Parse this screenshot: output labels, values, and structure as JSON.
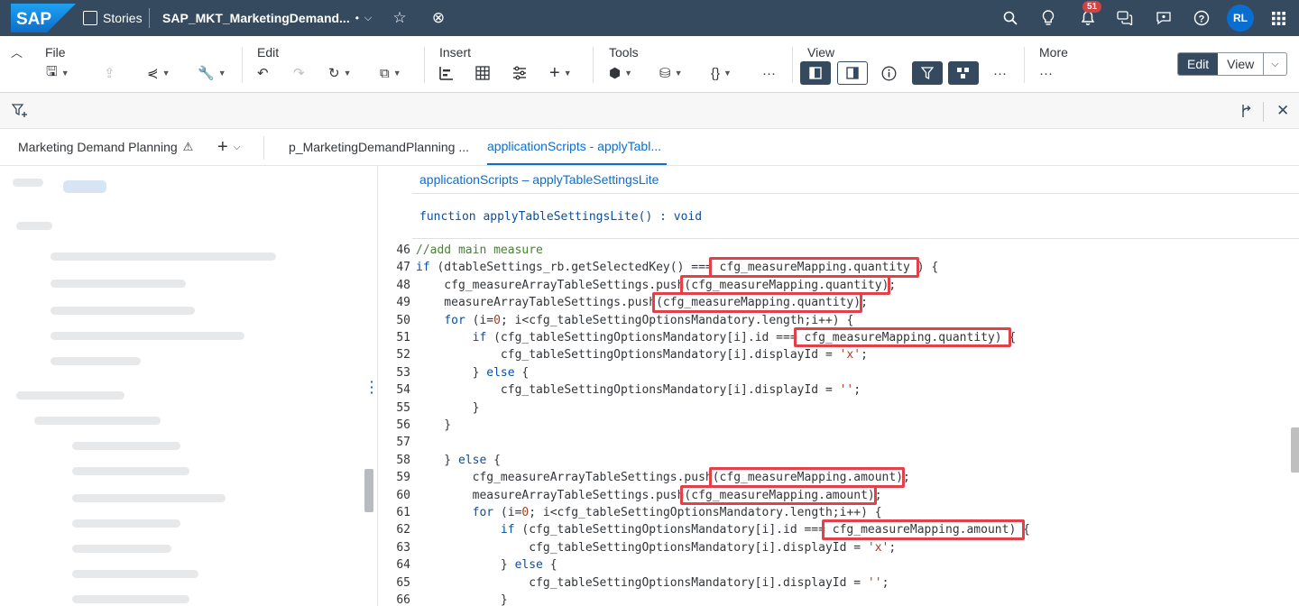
{
  "shell": {
    "logo_text": "SAP",
    "product": "Stories",
    "document_title": "SAP_MKT_MarketingDemand...",
    "modified_marker": "•",
    "notification_count": "51",
    "user_initials": "RL"
  },
  "toolbar": {
    "groups": [
      "File",
      "Edit",
      "Insert",
      "Tools",
      "View",
      "More"
    ],
    "mode_edit": "Edit",
    "mode_view": "View",
    "more_dots": "···"
  },
  "tabs": [
    {
      "label": "Marketing Demand Planning"
    },
    {
      "label": "p_MarketingDemandPlanning ..."
    },
    {
      "label": "applicationScripts - applyTabl..."
    }
  ],
  "editor": {
    "title": "applicationScripts – applyTableSettingsLite",
    "signature": "function applyTableSettingsLite() : void",
    "lines": [
      {
        "n": "46",
        "code": "//add main measure"
      },
      {
        "n": "47",
        "code": "if (dtableSettings_rb.getSelectedKey() === cfg_measureMapping.quantity ) {"
      },
      {
        "n": "48",
        "code": "    cfg_measureArrayTableSettings.push(cfg_measureMapping.quantity);"
      },
      {
        "n": "49",
        "code": "    measureArrayTableSettings.push(cfg_measureMapping.quantity);"
      },
      {
        "n": "50",
        "code": "    for (i=0; i<cfg_tableSettingOptionsMandatory.length;i++) {"
      },
      {
        "n": "51",
        "code": "        if (cfg_tableSettingOptionsMandatory[i].id === cfg_measureMapping.quantity) {"
      },
      {
        "n": "52",
        "code": "            cfg_tableSettingOptionsMandatory[i].displayId = 'x';"
      },
      {
        "n": "53",
        "code": "        } else {"
      },
      {
        "n": "54",
        "code": "            cfg_tableSettingOptionsMandatory[i].displayId = '';"
      },
      {
        "n": "55",
        "code": "        }"
      },
      {
        "n": "56",
        "code": "    }"
      },
      {
        "n": "57",
        "code": ""
      },
      {
        "n": "58",
        "code": "    } else {"
      },
      {
        "n": "59",
        "code": "        cfg_measureArrayTableSettings.push(cfg_measureMapping.amount);"
      },
      {
        "n": "60",
        "code": "        measureArrayTableSettings.push(cfg_measureMapping.amount);"
      },
      {
        "n": "61",
        "code": "        for (i=0; i<cfg_tableSettingOptionsMandatory.length;i++) {"
      },
      {
        "n": "62",
        "code": "            if (cfg_tableSettingOptionsMandatory[i].id === cfg_measureMapping.amount) {"
      },
      {
        "n": "63",
        "code": "                cfg_tableSettingOptionsMandatory[i].displayId = 'x';"
      },
      {
        "n": "64",
        "code": "            } else {"
      },
      {
        "n": "65",
        "code": "                cfg_tableSettingOptionsMandatory[i].displayId = '';"
      },
      {
        "n": "66",
        "code": "            }"
      }
    ]
  },
  "colors": {
    "shell": "#354a5f",
    "accent": "#0a6ed1",
    "highlight": "#e3404a",
    "badge": "#d04343"
  }
}
